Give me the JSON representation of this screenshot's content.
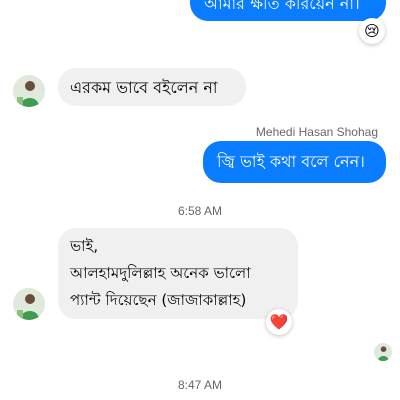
{
  "messages": [
    {
      "direction": "outgoing",
      "text": "আমার ক্ষতি করিয়েন না।",
      "reaction": "😢"
    },
    {
      "direction": "incoming",
      "text": "এরকম ভাবে বইলেন না"
    },
    {
      "direction": "outgoing",
      "sender": "Mehedi Hasan Shohag",
      "text": "জ্বি ভাই কথা বলে নেন।"
    },
    {
      "direction": "incoming",
      "text": "ভাই,\nআলহামদুলিল্লাহ অনেক ভালো\nপ্যান্ট দিয়েছেন (জাজাকাল্লাহ)",
      "reaction": "❤️"
    }
  ],
  "timestamps": [
    "6:58 AM",
    "8:47 AM"
  ],
  "colors": {
    "outgoing_bubble": "#0a7cff",
    "incoming_bubble": "#f0f0f0",
    "meta_text": "#65676b"
  },
  "icons": {
    "contact_avatar": "person-avatar-icon",
    "seen_indicator": "seen-avatar-icon"
  }
}
